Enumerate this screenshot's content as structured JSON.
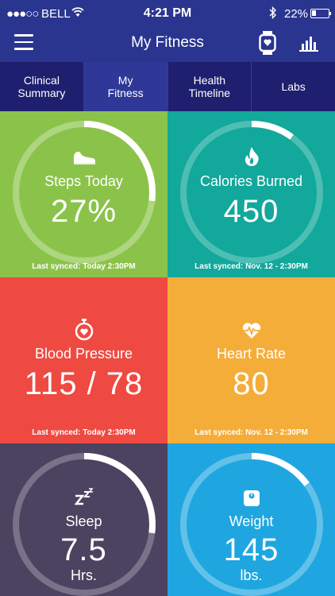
{
  "status_bar": {
    "signal": "●●●○○",
    "carrier": "BELL",
    "time": "4:21 PM",
    "battery": "22%",
    "battery_level": 0.22
  },
  "nav": {
    "title": "My Fitness"
  },
  "tabs": [
    {
      "label": "Clinical\nSummary",
      "active": false
    },
    {
      "label": "My\nFitness",
      "active": true
    },
    {
      "label": "Health\nTimeline",
      "active": false
    },
    {
      "label": "Labs",
      "active": false
    }
  ],
  "tiles": {
    "steps": {
      "label": "Steps Today",
      "value": "27%",
      "sync": "Last synced: Today 2:30PM",
      "progress": 0.27,
      "color": "#8bc34a",
      "icon": "shoe-icon"
    },
    "calories": {
      "label": "Calories Burned",
      "value": "450",
      "sync": "Last synced: Nov. 12 - 2:30PM",
      "progress": 0.1,
      "color": "#12a89b",
      "icon": "flame-icon"
    },
    "bp": {
      "label": "Blood Pressure",
      "value": "115 / 78",
      "sync": "Last synced: Today 2:30PM",
      "color": "#ee4a42",
      "icon": "stopwatch-heart-icon"
    },
    "hr": {
      "label": "Heart Rate",
      "value": "80",
      "sync": "Last synced: Nov. 12 - 2:30PM",
      "color": "#f5ad39",
      "icon": "heartbeat-icon"
    },
    "sleep": {
      "label": "Sleep",
      "value": "7.5",
      "unit": "Hrs.",
      "progress": 0.27,
      "color": "#4c4360",
      "icon": "zzz-icon"
    },
    "weight": {
      "label": "Weight",
      "value": "145",
      "unit": "lbs.",
      "progress": 0.15,
      "color": "#1fa6e0",
      "icon": "scale-icon"
    }
  }
}
